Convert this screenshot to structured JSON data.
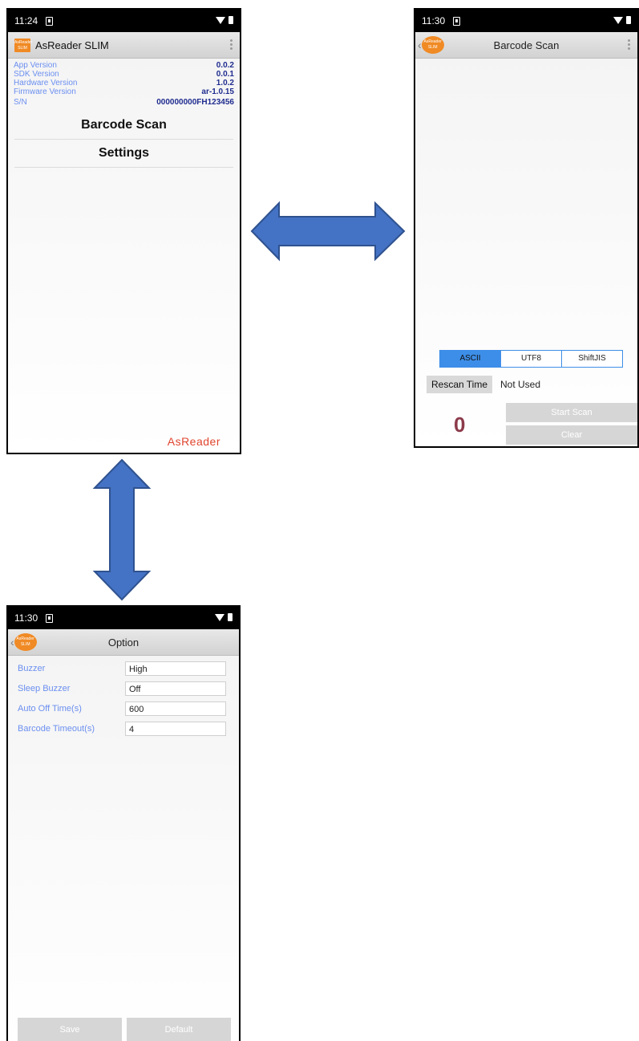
{
  "screen_main": {
    "status_time": "11:24",
    "app_logo_text": [
      "AsReader",
      "SLIM"
    ],
    "app_title": "AsReader SLIM",
    "info": [
      {
        "label": "App Version",
        "value": "0.0.2"
      },
      {
        "label": "SDK Version",
        "value": "0.0.1"
      },
      {
        "label": "Hardware Version",
        "value": "1.0.2"
      },
      {
        "label": "Firmware Version",
        "value": "ar-1.0.15"
      },
      {
        "label": "S/N",
        "value": "000000000FH123456"
      }
    ],
    "menu": [
      "Barcode Scan",
      "Settings"
    ],
    "brand": "AsReader"
  },
  "screen_scan": {
    "status_time": "11:30",
    "title": "Barcode Scan",
    "encodings": [
      "ASCII",
      "UTF8",
      "ShiftJIS"
    ],
    "active_encoding": "ASCII",
    "rescan_label": "Rescan Time",
    "rescan_value": "Not Used",
    "count": "0",
    "start_label": "Start Scan",
    "clear_label": "Clear"
  },
  "screen_option": {
    "status_time": "11:30",
    "title": "Option",
    "fields": [
      {
        "label": "Buzzer",
        "value": "High"
      },
      {
        "label": "Sleep Buzzer",
        "value": "Off"
      },
      {
        "label": "Auto Off Time(s)",
        "value": "600"
      },
      {
        "label": "Barcode Timeout(s)",
        "value": "4"
      }
    ],
    "save_label": "Save",
    "default_label": "Default"
  },
  "colors": {
    "arrow_fill": "#4472c4",
    "arrow_stroke": "#2f528f",
    "accent_orange": "#f08a24",
    "segment_blue": "#3d8ee8",
    "count_color": "#8b3a4a",
    "brand_red": "#e0452e"
  },
  "icons": [
    "sim-icon",
    "wifi-icon",
    "battery-icon",
    "overflow-menu-icon",
    "back-icon",
    "double-arrow-horizontal",
    "double-arrow-vertical"
  ]
}
